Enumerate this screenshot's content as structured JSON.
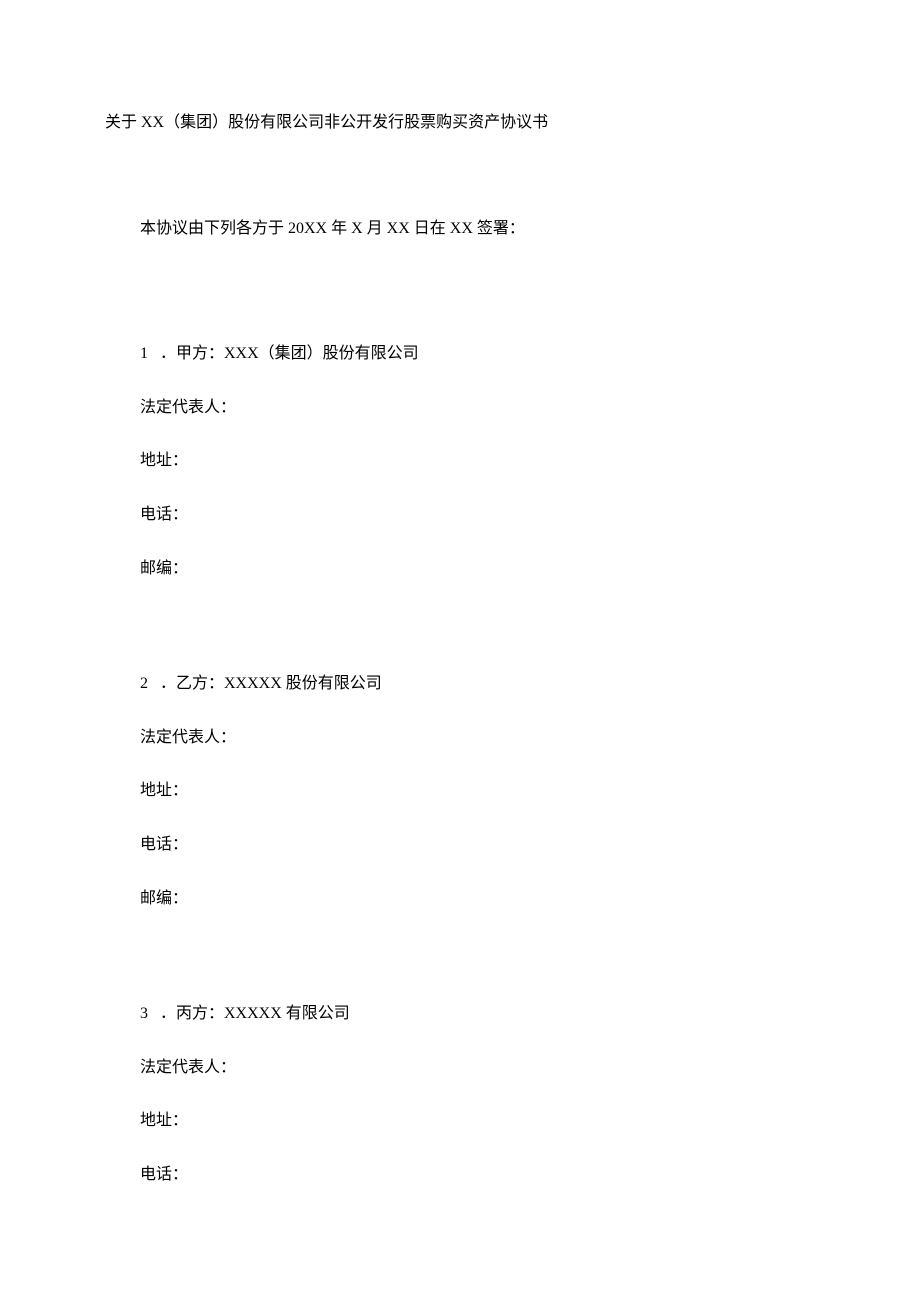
{
  "title": "关于 XX（集团）股份有限公司非公开发行股票购买资产协议书",
  "intro": "本协议由下列各方于 20XX 年 X 月 XX 日在 XX 签署：",
  "parties": {
    "a": {
      "num": "1",
      "label": "．甲方：XXX（集团）股份有限公司",
      "legal_rep": "法定代表人：",
      "address": "地址：",
      "phone": "电话：",
      "postcode": "邮编："
    },
    "b": {
      "num": "2",
      "label": "．乙方：XXXXX 股份有限公司",
      "legal_rep": "法定代表人：",
      "address": "地址：",
      "phone": "电话：",
      "postcode": "邮编："
    },
    "c": {
      "num": "3",
      "label": "．丙方：XXXXX 有限公司",
      "legal_rep": "法定代表人：",
      "address": "地址：",
      "phone": "电话："
    }
  }
}
